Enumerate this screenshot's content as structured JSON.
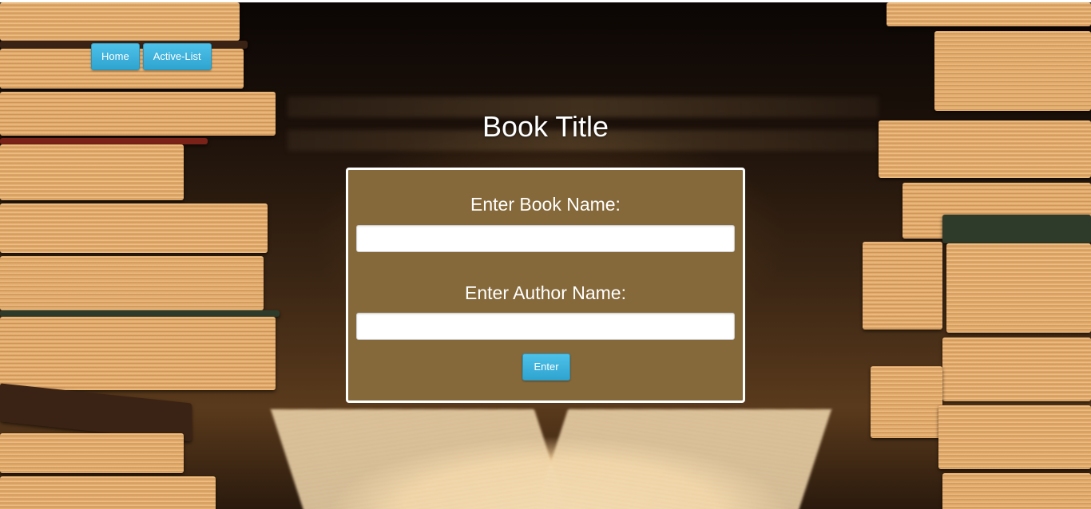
{
  "nav": {
    "home_label": "Home",
    "active_list_label": "Active-List"
  },
  "page": {
    "title": "Book Title"
  },
  "form": {
    "book_name_label": "Enter Book Name:",
    "book_name_value": "",
    "author_name_label": "Enter Author Name:",
    "author_name_value": "",
    "submit_label": "Enter"
  },
  "colors": {
    "button_accent": "#3bb3df",
    "form_background": "#86693a",
    "form_border": "#ffffff"
  }
}
